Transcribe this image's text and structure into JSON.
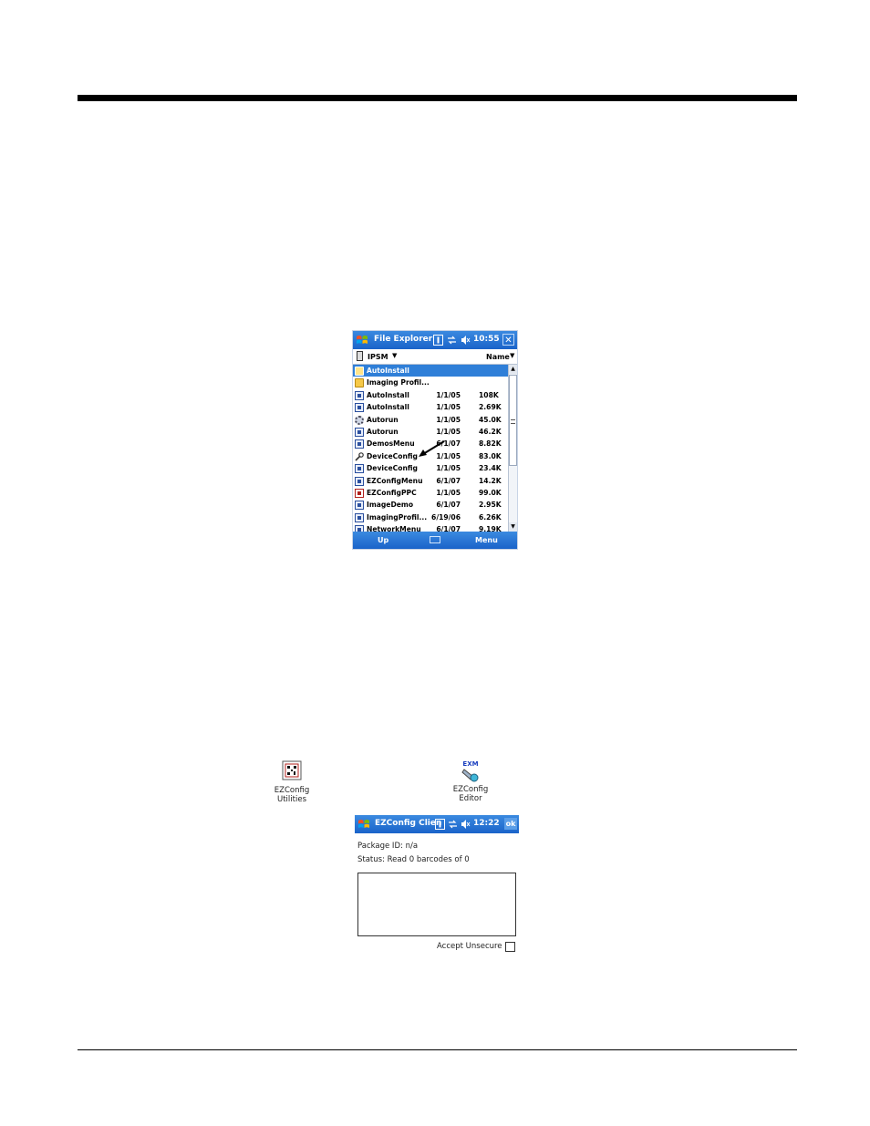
{
  "file_explorer": {
    "title": "File Explorer",
    "time": "10:55",
    "close_label": "✕",
    "location": "IPSM",
    "sort_by": "Name",
    "rows": [
      {
        "name": "AutoInstall",
        "date": "",
        "size": "",
        "icon": "folder-icon",
        "selected": true
      },
      {
        "name": "Imaging Profil...",
        "date": "",
        "size": "",
        "icon": "folder-icon",
        "selected": false
      },
      {
        "name": "AutoInstall",
        "date": "1/1/05",
        "size": "108K",
        "icon": "app-icon",
        "selected": false
      },
      {
        "name": "AutoInstall",
        "date": "1/1/05",
        "size": "2.69K",
        "icon": "app-icon",
        "selected": false
      },
      {
        "name": "Autorun",
        "date": "1/1/05",
        "size": "45.0K",
        "icon": "gear-icon",
        "selected": false
      },
      {
        "name": "Autorun",
        "date": "1/1/05",
        "size": "46.2K",
        "icon": "app-icon",
        "selected": false
      },
      {
        "name": "DemosMenu",
        "date": "6/1/07",
        "size": "8.82K",
        "icon": "app-icon",
        "selected": false
      },
      {
        "name": "DeviceConfig",
        "date": "1/1/05",
        "size": "83.0K",
        "icon": "wrench-icon",
        "selected": false
      },
      {
        "name": "DeviceConfig",
        "date": "1/1/05",
        "size": "23.4K",
        "icon": "app-icon",
        "selected": false
      },
      {
        "name": "EZConfigMenu",
        "date": "6/1/07",
        "size": "14.2K",
        "icon": "app-icon",
        "selected": false
      },
      {
        "name": "EZConfigPPC",
        "date": "1/1/05",
        "size": "99.0K",
        "icon": "red-app-icon",
        "selected": false
      },
      {
        "name": "ImageDemo",
        "date": "6/1/07",
        "size": "2.95K",
        "icon": "app-icon",
        "selected": false
      },
      {
        "name": "ImagingProfil...",
        "date": "6/19/06",
        "size": "6.26K",
        "icon": "app-icon",
        "selected": false
      },
      {
        "name": "NetworkMenu",
        "date": "6/1/07",
        "size": "9.19K",
        "icon": "app-icon",
        "selected": false
      }
    ],
    "softkey_left": "Up",
    "softkey_right": "Menu"
  },
  "desktop_icons": {
    "utilities": {
      "line1": "EZConfig",
      "line2": "Utilities"
    },
    "editor": {
      "badge": "EXM",
      "line1": "EZConfig",
      "line2": "Editor"
    }
  },
  "ezconfig_client": {
    "title": "EZConfig Clien",
    "time": "12:22",
    "ok_label": "ok",
    "package_id_label": "Package ID:",
    "package_id_value": "n/a",
    "status_label": "Status:",
    "status_value": "Read 0 barcodes of 0",
    "accept_unsecure_label": "Accept Unsecure"
  },
  "colors": {
    "titlebar": "#1a63c9",
    "selection": "#2f7fd8"
  }
}
